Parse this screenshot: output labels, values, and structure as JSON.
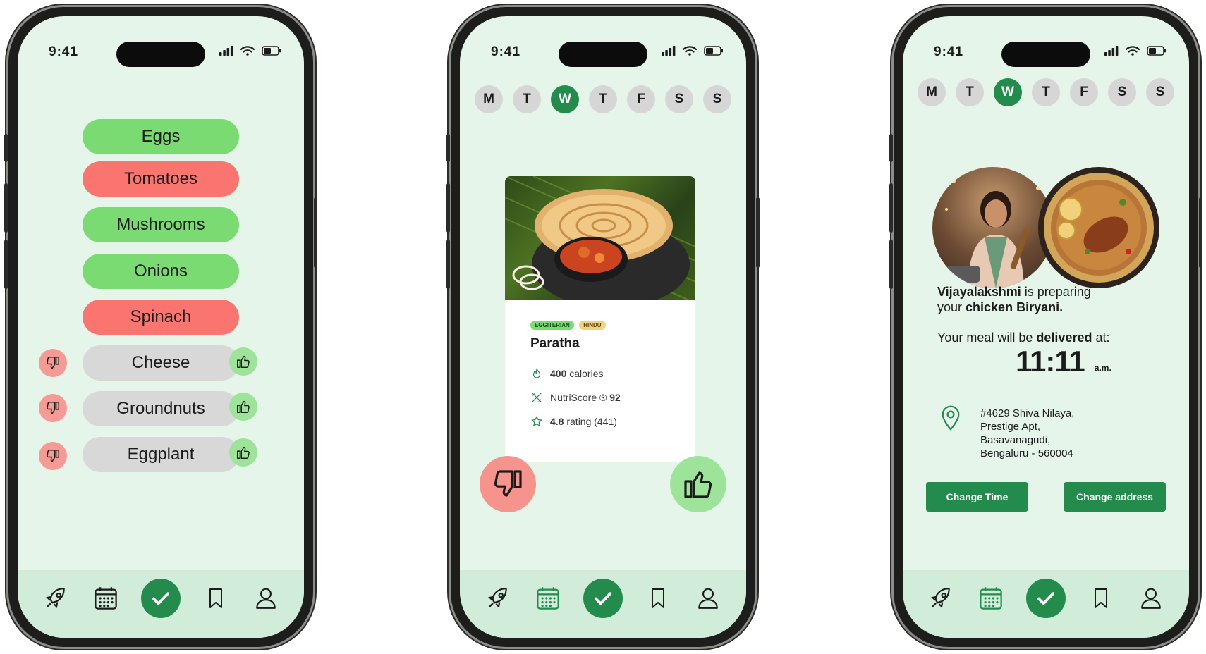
{
  "status": {
    "time": "9:41"
  },
  "phone1": {
    "ingredients": [
      {
        "label": "Eggs",
        "state": "liked"
      },
      {
        "label": "Tomatoes",
        "state": "disliked"
      },
      {
        "label": "Mushrooms",
        "state": "liked"
      },
      {
        "label": "Onions",
        "state": "liked"
      },
      {
        "label": "Spinach",
        "state": "disliked"
      },
      {
        "label": "Cheese",
        "state": "undecided"
      },
      {
        "label": "Groundnuts",
        "state": "undecided"
      },
      {
        "label": "Eggplant",
        "state": "undecided"
      }
    ]
  },
  "days": [
    "M",
    "T",
    "W",
    "T",
    "F",
    "S",
    "S"
  ],
  "active_day_index": 2,
  "phone2": {
    "tags": [
      "EGGITERIAN",
      "HINDU"
    ],
    "dish": "Paratha",
    "calories_value": "400",
    "calories_unit": "calories",
    "nutri_label": "NutriScore ®",
    "nutri_value": "92",
    "rating_value": "4.8",
    "rating_rest": "rating (441)"
  },
  "phone3": {
    "chef_name": "Vijayalakshmi",
    "preparing_text": "is preparing",
    "your_text": "your",
    "meal_name": "chicken Biryani.",
    "delivery_prefix": "Your meal will be",
    "delivery_bold": "delivered",
    "delivery_suffix": "at:",
    "delivery_time": "11:11",
    "delivery_ampm": "a.m.",
    "address_lines": [
      "#4629 Shiva Nilaya,",
      "Prestige Apt,",
      "Basavanagudi,",
      "Bengaluru - 560004"
    ],
    "change_time_label": "Change Time",
    "change_address_label": "Change address"
  },
  "colors": {
    "background": "#e6f5ea",
    "tabbar": "#d2ecda",
    "accent": "#238c4c",
    "liked": "#7bdb73",
    "disliked": "#fa7570",
    "neutral": "#d8d8d8",
    "thumbs_down_bg": "#f59a94",
    "thumbs_up_bg": "#9ee39a"
  },
  "icons": {
    "status": [
      "signal-icon",
      "wifi-icon",
      "battery-icon"
    ],
    "tabbar": [
      "rocket-icon",
      "calendar-icon",
      "checkmark-icon",
      "bookmark-icon",
      "profile-icon"
    ],
    "card": [
      "flame-icon",
      "utensils-icon",
      "star-icon"
    ],
    "votes": [
      "thumbs-down-icon",
      "thumbs-up-icon"
    ],
    "location": "location-pin-icon"
  }
}
